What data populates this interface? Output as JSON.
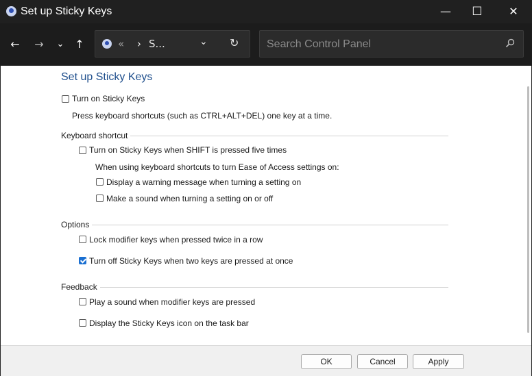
{
  "window": {
    "title": "Set up Sticky Keys",
    "controls": {
      "minimize": "—",
      "maximize": "☐",
      "close": "✕"
    }
  },
  "nav": {
    "back": "←",
    "forward": "→",
    "recent": "⌄",
    "up": "↑",
    "address_chevrons": "«",
    "address_sep": "›",
    "address_text": "S...",
    "address_dropdown": "⌄",
    "refresh": "↻"
  },
  "search": {
    "placeholder": "Search Control Panel"
  },
  "page": {
    "heading": "Set up Sticky Keys",
    "turn_on": {
      "label": "Turn on Sticky Keys",
      "checked": false
    },
    "turn_on_desc": "Press keyboard shortcuts (such as CTRL+ALT+DEL) one key at a time.",
    "keyboard_shortcut": {
      "title": "Keyboard shortcut",
      "shift_five": {
        "label": "Turn on Sticky Keys when SHIFT is pressed five times",
        "checked": false
      },
      "note": "When using keyboard shortcuts to turn Ease of Access settings on:",
      "warning": {
        "label": "Display a warning message when turning a setting on",
        "checked": false
      },
      "sound": {
        "label": "Make a sound when turning a setting on or off",
        "checked": false
      }
    },
    "options": {
      "title": "Options",
      "lock_modifier": {
        "label": "Lock modifier keys when pressed twice in a row",
        "checked": false
      },
      "turn_off_two": {
        "label": "Turn off Sticky Keys when two keys are pressed at once",
        "checked": true
      }
    },
    "feedback": {
      "title": "Feedback",
      "play_sound": {
        "label": "Play a sound when modifier keys are pressed",
        "checked": false
      },
      "show_icon": {
        "label": "Display the Sticky Keys icon on the task bar",
        "checked": false
      }
    }
  },
  "footer": {
    "ok": "OK",
    "cancel": "Cancel",
    "apply": "Apply"
  }
}
